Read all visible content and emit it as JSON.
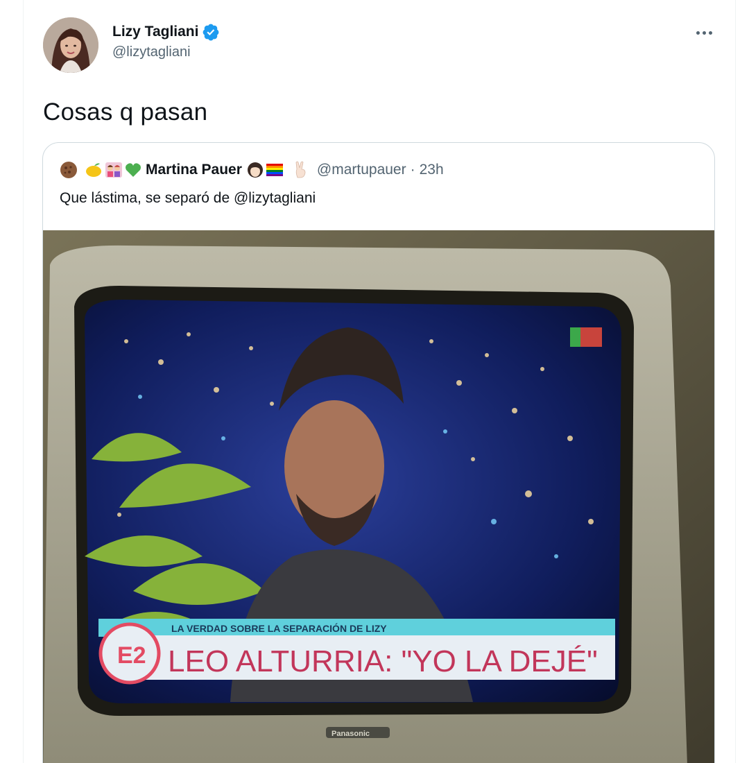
{
  "tweet": {
    "display_name": "Lizy Tagliani",
    "handle": "@lizytagliani",
    "text": "Cosas q pasan",
    "verified": true
  },
  "quoted": {
    "display_name": "Martina Pauer",
    "handle": "@martupauer",
    "separator": "·",
    "time": "23h",
    "text": "Que lástima, se separó de @lizytagliani",
    "emoji_icons": [
      "cookie-icon",
      "lemon-icon",
      "couple-icon",
      "green-heart-icon"
    ],
    "trailing_icons": [
      "woman-face-icon",
      "rainbow-flag-icon",
      "victory-hand-icon"
    ]
  },
  "media": {
    "overlay_subtitle": "LA VERDAD SOBRE LA SEPARACIÓN DE LIZY",
    "overlay_headline": "LEO ALTURRIA: \"YO LA DEJÉ\"",
    "channel_badge": "E2",
    "tv_brand": "Panasonic"
  },
  "colors": {
    "verified": "#1d9bf0",
    "secondary_text": "#536471",
    "border": "#cfd9de",
    "overlay_band": "#5fd0dc",
    "overlay_headline_bg": "#e8eef4"
  }
}
